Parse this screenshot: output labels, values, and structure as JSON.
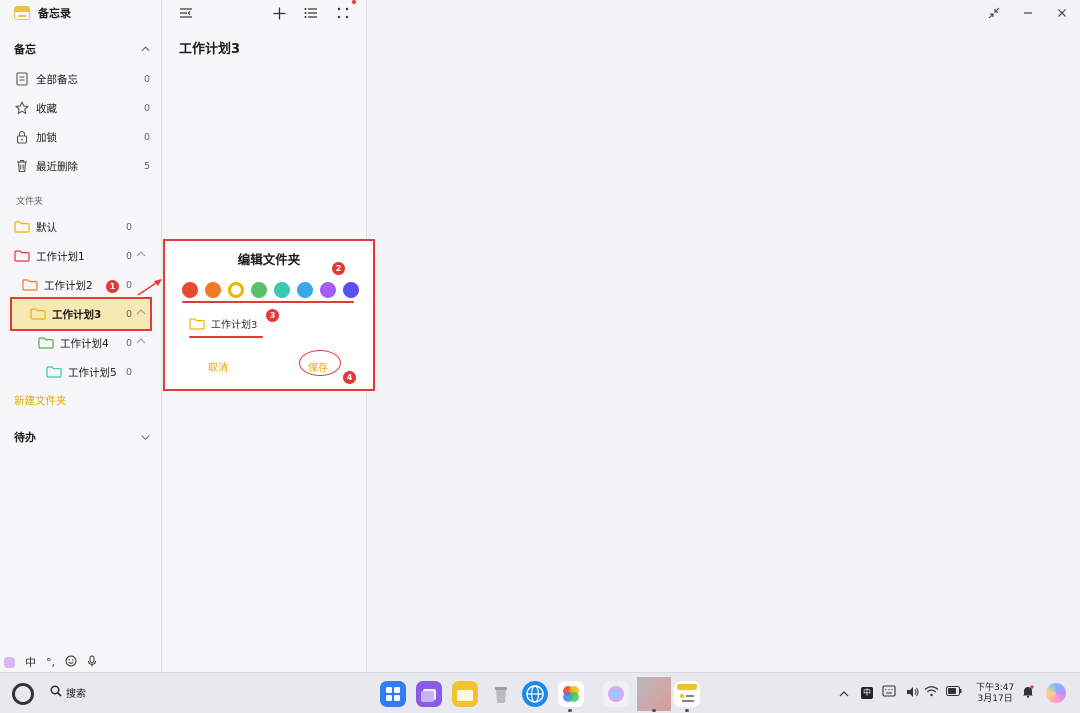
{
  "app": {
    "title": "备忘录"
  },
  "sidebar": {
    "notes_section": "备忘",
    "items": [
      {
        "label": "全部备忘",
        "count": "0",
        "icon": "document-icon"
      },
      {
        "label": "收藏",
        "count": "0",
        "icon": "star-icon"
      },
      {
        "label": "加锁",
        "count": "0",
        "icon": "lock-icon"
      },
      {
        "label": "最近删除",
        "count": "5",
        "icon": "trash-icon"
      }
    ],
    "folders_label": "文件夹",
    "folders": [
      {
        "label": "默认",
        "count": "0",
        "color": "#f0b400"
      },
      {
        "label": "工作计划1",
        "count": "0",
        "color": "#e53935"
      },
      {
        "label": "工作计划2",
        "count": "0",
        "color": "#f07a2a"
      },
      {
        "label": "工作计划3",
        "count": "0",
        "color": "#f0b400"
      },
      {
        "label": "工作计划4",
        "count": "0",
        "color": "#4caf50"
      },
      {
        "label": "工作计划5",
        "count": "0",
        "color": "#3cc7b0"
      }
    ],
    "new_folder": "新建文件夹",
    "todo_section": "待办"
  },
  "ime": {
    "mode": "中",
    "punct": "°,"
  },
  "list": {
    "title": "工作计划3"
  },
  "dialog": {
    "title": "编辑文件夹",
    "colors": [
      "#e84a2f",
      "#f07a2a",
      "#f0b400",
      "#5cbf6a",
      "#3cc7b0",
      "#3aa8e8",
      "#a25ef5",
      "#5a4ff0"
    ],
    "selected_color_index": 2,
    "folder_name": "工作计划3",
    "cancel": "取消",
    "save": "保存"
  },
  "annotations": [
    "1",
    "2",
    "3",
    "4"
  ],
  "taskbar": {
    "search": "搜索",
    "time": "下午3:47",
    "date": "3月17日",
    "ime": "中"
  }
}
